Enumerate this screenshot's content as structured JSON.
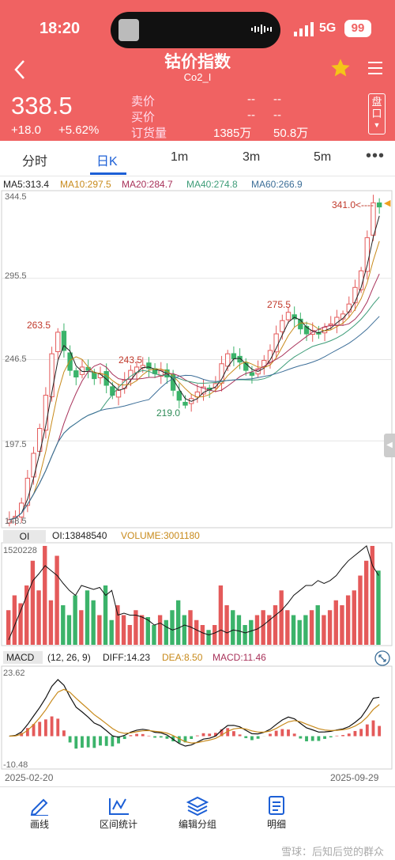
{
  "status": {
    "time": "18:20",
    "network": "5G",
    "battery": "99"
  },
  "header": {
    "title": "钴价指数",
    "subtitle": "Co2_I",
    "price": "338.5",
    "change": "+18.0",
    "change_pct": "+5.62%",
    "sell_label": "卖价",
    "sell_value1": "--",
    "sell_value2": "--",
    "buy_label": "买价",
    "buy_value1": "--",
    "buy_value2": "--",
    "order_label": "订货量",
    "order_value1": "1385万",
    "order_value2": "50.8万",
    "pankou": "盘口"
  },
  "tabs": [
    "分时",
    "日K",
    "1m",
    "3m",
    "5m"
  ],
  "tabs_active": "日K",
  "ma": {
    "ma5": "MA5:313.4",
    "ma10": "MA10:297.5",
    "ma20": "MA20:284.7",
    "ma40": "MA40:274.8",
    "ma60": "MA60:266.9"
  },
  "colors": {
    "header": "#f06262",
    "up": "#e45a5a",
    "down": "#3bb36a",
    "ma5": "#222222",
    "ma10": "#c88a1b",
    "ma20": "#a8325a",
    "ma40": "#3d9c78",
    "ma60": "#3c6e98",
    "active": "#1c5fd6"
  },
  "price_axis": {
    "ticks": [
      "344.5",
      "295.5",
      "246.5",
      "197.5",
      "148.5"
    ],
    "max": 344.5,
    "min": 148.5
  },
  "annotations": {
    "high_1": "263.5",
    "high_2": "243.5",
    "low_1": "219.0",
    "high_3": "275.5",
    "last": "341.0<----"
  },
  "oi_panel": {
    "tab": "OI",
    "oi": "OI:13848540",
    "volume": "VOLUME:3001180",
    "max_tick": "1520228"
  },
  "macd_panel": {
    "label": "MACD",
    "params": "(12, 26, 9)",
    "diff": "DIFF:14.23",
    "dea": "DEA:8.50",
    "macd": "MACD:11.46",
    "max_tick": "23.62",
    "min_tick": "-10.48"
  },
  "dates": {
    "start": "2025-02-20",
    "end": "2025-09-29"
  },
  "toolbar": [
    {
      "icon": "pen-icon",
      "label": "画线"
    },
    {
      "icon": "stats-icon",
      "label": "区间统计"
    },
    {
      "icon": "layers-icon",
      "label": "编辑分组"
    },
    {
      "icon": "list-icon",
      "label": "明细"
    }
  ],
  "watermark": "雪球：后知后觉的群众",
  "chart_data": [
    {
      "type": "candlestick",
      "title": "钴价指数 日K",
      "x_start": "2025-02-20",
      "x_end": "2025-09-29",
      "ylim": [
        148.5,
        344.5
      ],
      "price_path": [
        150,
        152,
        160,
        175,
        190,
        205,
        225,
        250,
        263,
        252,
        240,
        236,
        242,
        240,
        235,
        238,
        231,
        225,
        228,
        234,
        240,
        242,
        243,
        241,
        238,
        240,
        236,
        228,
        222,
        219,
        223,
        227,
        230,
        228,
        232,
        244,
        250,
        247,
        245,
        240,
        237,
        241,
        246,
        252,
        262,
        270,
        275,
        271,
        265,
        262,
        264,
        262,
        266,
        268,
        272,
        274,
        280,
        290,
        300,
        320,
        341,
        338.5
      ],
      "ma5_last": 313.4,
      "ma10_last": 297.5,
      "ma20_last": 284.7,
      "ma40_last": 274.8,
      "ma60_last": 266.9,
      "marked": [
        {
          "label": "263.5",
          "value": 263.5
        },
        {
          "label": "243.5",
          "value": 243.5
        },
        {
          "label": "219.0",
          "value": 219.0
        },
        {
          "label": "275.5",
          "value": 275.5
        },
        {
          "label": "341.0",
          "value": 341.0
        }
      ]
    },
    {
      "type": "bar",
      "title": "OI / VOLUME",
      "oi_last": 13848540,
      "volume_last": 3001180,
      "ymax": 1520228,
      "volume_rel": [
        0.35,
        0.5,
        0.42,
        0.6,
        0.85,
        0.55,
        1.0,
        0.45,
        0.9,
        0.4,
        0.3,
        0.5,
        0.35,
        0.55,
        0.45,
        0.3,
        0.6,
        0.25,
        0.4,
        0.3,
        0.2,
        0.35,
        0.3,
        0.28,
        0.2,
        0.3,
        0.25,
        0.35,
        0.45,
        0.3,
        0.35,
        0.25,
        0.2,
        0.15,
        0.2,
        0.6,
        0.4,
        0.35,
        0.3,
        0.2,
        0.25,
        0.3,
        0.35,
        0.3,
        0.4,
        0.55,
        0.35,
        0.3,
        0.25,
        0.3,
        0.35,
        0.4,
        0.3,
        0.35,
        0.45,
        0.4,
        0.5,
        0.55,
        0.7,
        0.85,
        1.0,
        0.75
      ],
      "oi_rel": [
        0.05,
        0.2,
        0.35,
        0.5,
        0.65,
        0.72,
        0.8,
        0.75,
        0.7,
        0.62,
        0.55,
        0.5,
        0.6,
        0.58,
        0.56,
        0.58,
        0.5,
        0.55,
        0.3,
        0.32,
        0.3,
        0.3,
        0.28,
        0.25,
        0.2,
        0.22,
        0.18,
        0.15,
        0.17,
        0.2,
        0.18,
        0.15,
        0.12,
        0.1,
        0.12,
        0.15,
        0.12,
        0.15,
        0.14,
        0.12,
        0.14,
        0.16,
        0.2,
        0.25,
        0.3,
        0.35,
        0.42,
        0.5,
        0.55,
        0.6,
        0.6,
        0.65,
        0.62,
        0.65,
        0.7,
        0.78,
        0.85,
        0.9,
        0.95,
        1.0,
        0.8,
        0.7
      ]
    },
    {
      "type": "line",
      "title": "MACD (12, 26, 9)",
      "ylim": [
        -10.48,
        23.62
      ],
      "diff_last": 14.23,
      "dea_last": 8.5,
      "macd_last": 11.46
    }
  ]
}
